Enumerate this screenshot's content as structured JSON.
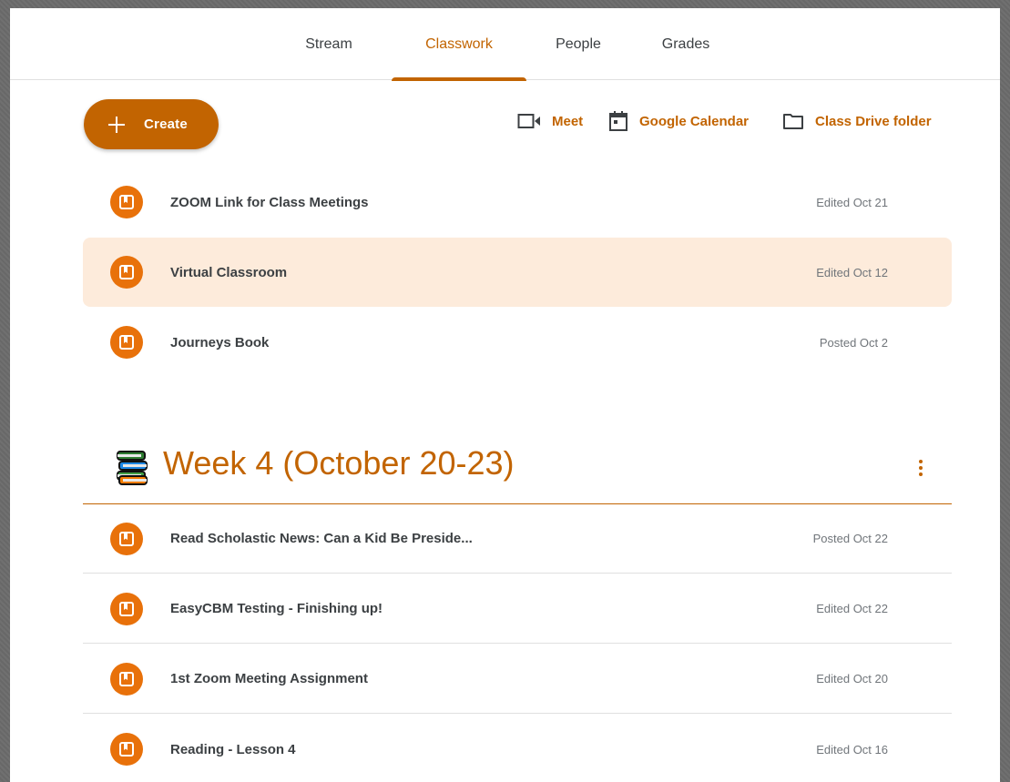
{
  "tabs": [
    {
      "label": "Stream",
      "active": false
    },
    {
      "label": "Classwork",
      "active": true
    },
    {
      "label": "People",
      "active": false
    },
    {
      "label": "Grades",
      "active": false
    }
  ],
  "toolbar": {
    "create_label": "Create",
    "meet_label": "Meet",
    "calendar_label": "Google Calendar",
    "drive_label": "Class Drive folder"
  },
  "pinned_items": [
    {
      "title": "ZOOM Link for Class Meetings",
      "meta": "Edited Oct 21",
      "icon": "material-icon"
    },
    {
      "title": "Virtual Classroom",
      "meta": "Edited Oct 12",
      "icon": "material-icon"
    },
    {
      "title": "Journeys Book",
      "meta": "Posted Oct 2",
      "icon": "material-icon"
    }
  ],
  "topic": {
    "title": "Week 4 (October 20-23)",
    "items": [
      {
        "title": "Read Scholastic News: Can a Kid Be Preside...",
        "meta": "Posted Oct 22",
        "icon": "material-icon"
      },
      {
        "title": "EasyCBM Testing - Finishing up!",
        "meta": "Edited Oct 22",
        "icon": "material-icon"
      },
      {
        "title": "1st Zoom Meeting Assignment",
        "meta": "Edited Oct 20",
        "icon": "material-icon"
      },
      {
        "title": "Reading - Lesson 4",
        "meta": "Edited Oct 16",
        "icon": "material-icon"
      }
    ]
  },
  "colors": {
    "accent": "#c26401",
    "badge": "#e8710a",
    "highlight": "#fdebdb"
  }
}
